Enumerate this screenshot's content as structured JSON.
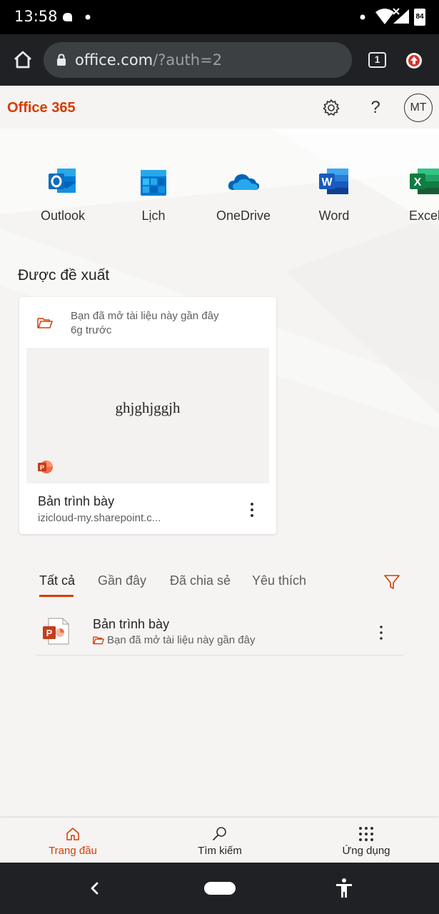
{
  "status_bar": {
    "time": "13:58",
    "battery": "84"
  },
  "browser": {
    "url_domain": "office.com",
    "url_path": "/?auth=2",
    "tab_count": "1"
  },
  "header": {
    "brand": "Office 365",
    "help_symbol": "?",
    "avatar_initials": "MT"
  },
  "apps": [
    {
      "label": "Outlook",
      "icon": "outlook-icon"
    },
    {
      "label": "Lịch",
      "icon": "calendar-icon"
    },
    {
      "label": "OneDrive",
      "icon": "onedrive-icon"
    },
    {
      "label": "Word",
      "icon": "word-icon"
    },
    {
      "label": "Excel",
      "icon": "excel-icon"
    }
  ],
  "recommended": {
    "title": "Được đề xuất",
    "card": {
      "activity": "Bạn đã mở tài liệu này gần đây",
      "time": "6g trước",
      "preview_text": "ghjghjggjh",
      "name": "Bản trình bày",
      "location": "izicloud-my.sharepoint.c..."
    }
  },
  "tabs": [
    {
      "label": "Tất cả",
      "active": true
    },
    {
      "label": "Gần đây",
      "active": false
    },
    {
      "label": "Đã chia sẻ",
      "active": false
    },
    {
      "label": "Yêu thích",
      "active": false
    }
  ],
  "files": [
    {
      "name": "Bản trình bày",
      "activity": "Bạn đã mở tài liệu này gần đây"
    }
  ],
  "bottom_nav": [
    {
      "label": "Trang đầu",
      "icon": "home-icon",
      "active": true
    },
    {
      "label": "Tìm kiếm",
      "icon": "search-icon",
      "active": false
    },
    {
      "label": "Ứng dụng",
      "icon": "apps-grid-icon",
      "active": false
    }
  ],
  "colors": {
    "brand": "#d83b01",
    "background": "#f5f4f3",
    "chrome": "#202124"
  }
}
